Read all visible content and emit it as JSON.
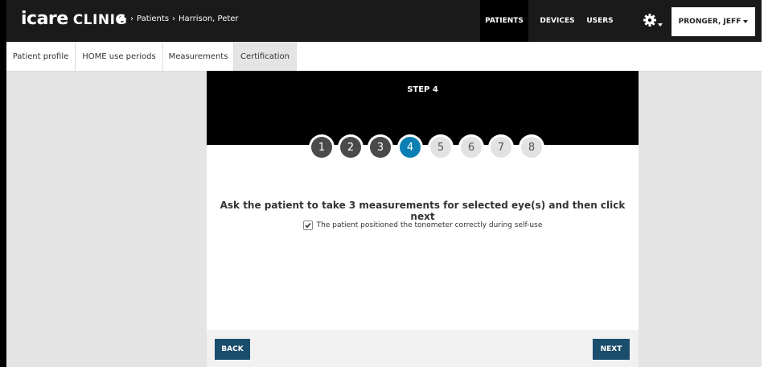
{
  "app": {
    "logo_main": "icare",
    "logo_sub": "CLINIC"
  },
  "breadcrumb": {
    "home_icon": "home-icon",
    "items": [
      "Patients",
      "Harrison, Peter"
    ],
    "separator": "›"
  },
  "nav": {
    "patients": "PATIENTS",
    "devices": "DEVICES",
    "users": "USERS",
    "settings_icon": "gear-icon",
    "user": "PRONGER, JEFF"
  },
  "tabs": [
    {
      "label": "Patient profile",
      "active": false
    },
    {
      "label": "HOME use periods",
      "active": false
    },
    {
      "label": "Measurements",
      "active": false
    },
    {
      "label": "Certification",
      "active": true
    }
  ],
  "wizard": {
    "step_title": "STEP 4",
    "steps": [
      "1",
      "2",
      "3",
      "4",
      "5",
      "6",
      "7",
      "8"
    ],
    "current_step": 4,
    "instruction": "Ask the patient to take 3 measurements for selected eye(s) and then click next",
    "checkbox_label": "The patient positioned the tonometer correctly during self-use",
    "checkbox_checked": true,
    "back_label": "BACK",
    "next_label": "NEXT"
  },
  "colors": {
    "accent": "#0b7fb3",
    "button": "#1b4d6d",
    "topbar": "#1a1a1a"
  }
}
